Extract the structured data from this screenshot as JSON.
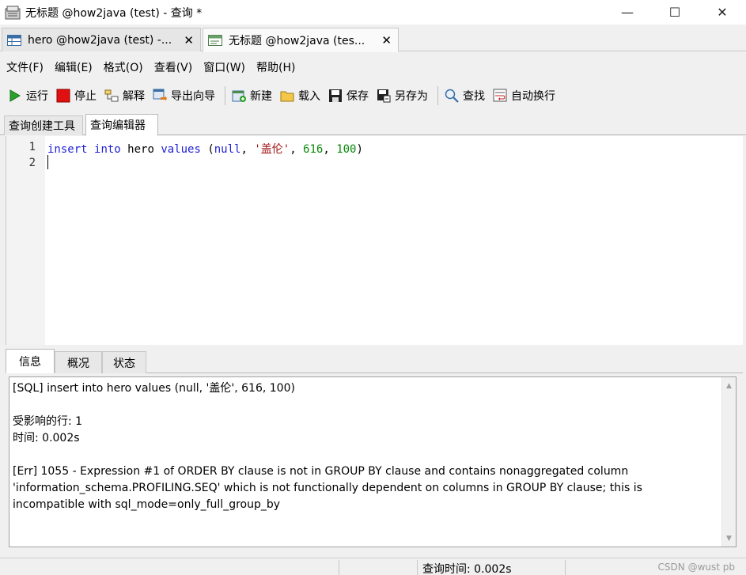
{
  "window": {
    "title": "无标题 @how2java (test) - 查询 *",
    "minimize_glyph": "—",
    "maximize_glyph": "☐",
    "close_glyph": "✕"
  },
  "doc_tabs": [
    {
      "label": "hero @how2java (test) -...",
      "close": "✕"
    },
    {
      "label": "无标题 @how2java (tes...",
      "close": "✕"
    }
  ],
  "menu": [
    "文件(F)",
    "编辑(E)",
    "格式(O)",
    "查看(V)",
    "窗口(W)",
    "帮助(H)"
  ],
  "toolbar": {
    "run": "运行",
    "stop": "停止",
    "explain": "解释",
    "export_wizard": "导出向导",
    "new": "新建",
    "load": "载入",
    "save": "保存",
    "save_as": "另存为",
    "find": "查找",
    "word_wrap": "自动换行"
  },
  "sub_tabs": [
    "查询创建工具",
    "查询编辑器"
  ],
  "editor": {
    "line_numbers": [
      "1",
      "2"
    ],
    "line1": {
      "t1": "insert",
      "t2": " ",
      "t3": "into",
      "t4": " hero ",
      "t5": "values",
      "t6": " (",
      "t7": "null",
      "t8": ", ",
      "t9": "'盖伦'",
      "t10": ", ",
      "t11": "616",
      "t12": ", ",
      "t13": "100",
      "t14": ")"
    }
  },
  "bottom_tabs": [
    "信息",
    "概况",
    "状态"
  ],
  "message": "[SQL] insert into hero values (null, '盖伦', 616, 100)\n\n受影响的行: 1\n时间: 0.002s\n\n[Err] 1055 - Expression #1 of ORDER BY clause is not in GROUP BY clause and contains nonaggregated column 'information_schema.PROFILING.SEQ' which is not functionally dependent on columns in GROUP BY clause; this is incompatible with sql_mode=only_full_group_by",
  "status": {
    "query_time": "查询时间: 0.002s",
    "watermark": "CSDN @wust pb"
  },
  "colors": {
    "keyword": "#1f1fd6",
    "string": "#a31515",
    "number": "#0a8a0a",
    "stop_red": "#e01010",
    "run_green": "#2aa02a"
  }
}
